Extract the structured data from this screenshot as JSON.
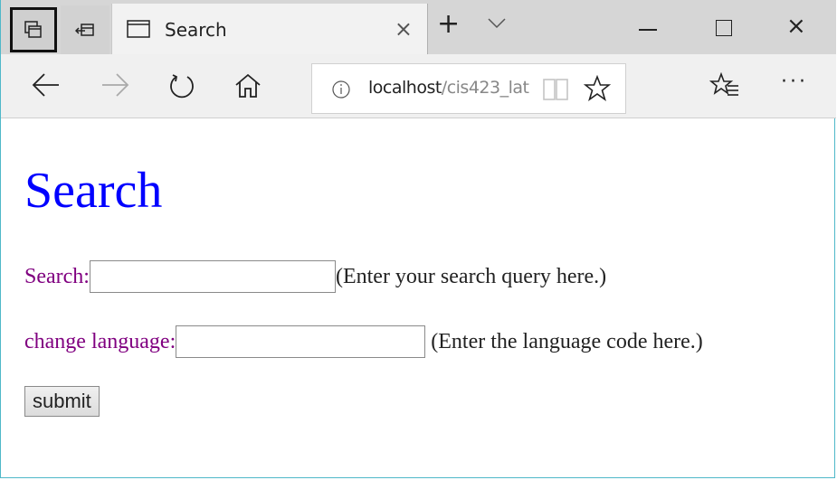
{
  "browser": {
    "tab": {
      "title": "Search",
      "icon": "page-icon"
    },
    "tab_buttons": {
      "tabs_aside": "tab-overview-icon",
      "set_aside": "set-tabs-aside-icon",
      "new_tab": "+",
      "close_tab": "×"
    },
    "window_controls": {
      "minimize": "minimize-icon",
      "maximize": "maximize-icon",
      "close": "×"
    },
    "nav": {
      "back": "back-arrow-icon",
      "forward": "forward-arrow-icon",
      "refresh": "refresh-icon",
      "home": "home-icon"
    },
    "address": {
      "host": "localhost",
      "path": "/cis423_lat"
    },
    "toolbar": {
      "more": "···"
    }
  },
  "page": {
    "heading": "Search",
    "search": {
      "label": "Search:",
      "value": "",
      "hint": "(Enter your search query here.)"
    },
    "language": {
      "label": "change language:",
      "value": "",
      "hint": "(Enter the language code here.)"
    },
    "submit_label": "submit"
  }
}
